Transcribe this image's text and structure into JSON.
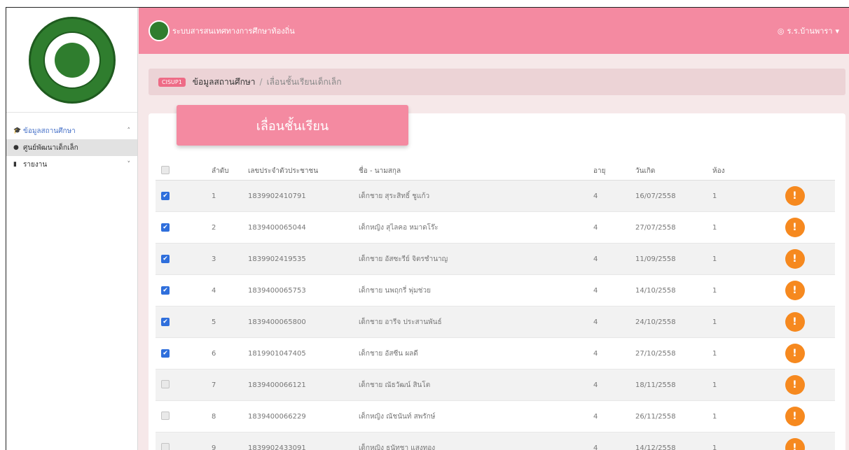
{
  "app": {
    "title": "ระบบสารสนเทศทางการศึกษาท้องถิ่น",
    "user": "ร.ร.บ้านพารา",
    "user_icon": "user-circle-icon"
  },
  "sidebar": {
    "items": [
      {
        "label": "ข้อมูลสถานศึกษา",
        "icon": "graduation-cap-icon",
        "chevron": "˄"
      },
      {
        "label": "ศูนย์พัฒนาเด็กเล็ก",
        "icon": "circle-icon"
      },
      {
        "label": "รายงาน",
        "icon": "file-icon",
        "chevron": "˅"
      }
    ]
  },
  "breadcrumb": {
    "badge": "CISUP1",
    "items": [
      "ข้อมูลสถานศึกษา",
      "เลื่อนชั้นเรียนเด็กเล็ก"
    ],
    "separator": "/"
  },
  "card": {
    "title": "เลื่อนชั้นเรียน"
  },
  "table": {
    "headers": [
      "ลำดับ",
      "เลขประจำตัวประชาชน",
      "ชื่อ - นามสกุล",
      "อายุ",
      "วันเกิด",
      "ห้อง"
    ],
    "rows": [
      {
        "checked": true,
        "no": "1",
        "id": "1839902410791",
        "name": "เด็กชาย สุระสิทธิ์ ชูแก้ว",
        "age": "4",
        "dob": "16/07/2558",
        "room": "1"
      },
      {
        "checked": true,
        "no": "2",
        "id": "1839400065044",
        "name": "เด็กหญิง สุไลคอ หมาดโร๊ะ",
        "age": "4",
        "dob": "27/07/2558",
        "room": "1"
      },
      {
        "checked": true,
        "no": "3",
        "id": "1839902419535",
        "name": "เด็กชาย อัสซะรีย์ จิตรชำนาญ",
        "age": "4",
        "dob": "11/09/2558",
        "room": "1"
      },
      {
        "checked": true,
        "no": "4",
        "id": "1839400065753",
        "name": "เด็กชาย นพฤกรี่ พุ่มช่วย",
        "age": "4",
        "dob": "14/10/2558",
        "room": "1"
      },
      {
        "checked": true,
        "no": "5",
        "id": "1839400065800",
        "name": "เด็กชาย อารีจ ประสานพันธ์",
        "age": "4",
        "dob": "24/10/2558",
        "room": "1"
      },
      {
        "checked": true,
        "no": "6",
        "id": "1819901047405",
        "name": "เด็กชาย อัสซีน ผลดี",
        "age": "4",
        "dob": "27/10/2558",
        "room": "1"
      },
      {
        "checked": false,
        "no": "7",
        "id": "1839400066121",
        "name": "เด็กชาย ณัธวัฒน์ สินโต",
        "age": "4",
        "dob": "18/11/2558",
        "room": "1"
      },
      {
        "checked": false,
        "no": "8",
        "id": "1839400066229",
        "name": "เด็กหญิง ณัชนันท์ สพรักษ์",
        "age": "4",
        "dob": "26/11/2558",
        "room": "1"
      },
      {
        "checked": false,
        "no": "9",
        "id": "1839902433091",
        "name": "เด็กหญิง ธนัทชา แสงทอง",
        "age": "4",
        "dob": "14/12/2558",
        "room": "1"
      }
    ]
  },
  "colors": {
    "topbar": "#f48aa1",
    "breadcrumb_bg": "#ecd3d6",
    "badge": "#ee6b86",
    "checkbox_on": "#2f6fdc",
    "info_button": "#f6891f"
  }
}
